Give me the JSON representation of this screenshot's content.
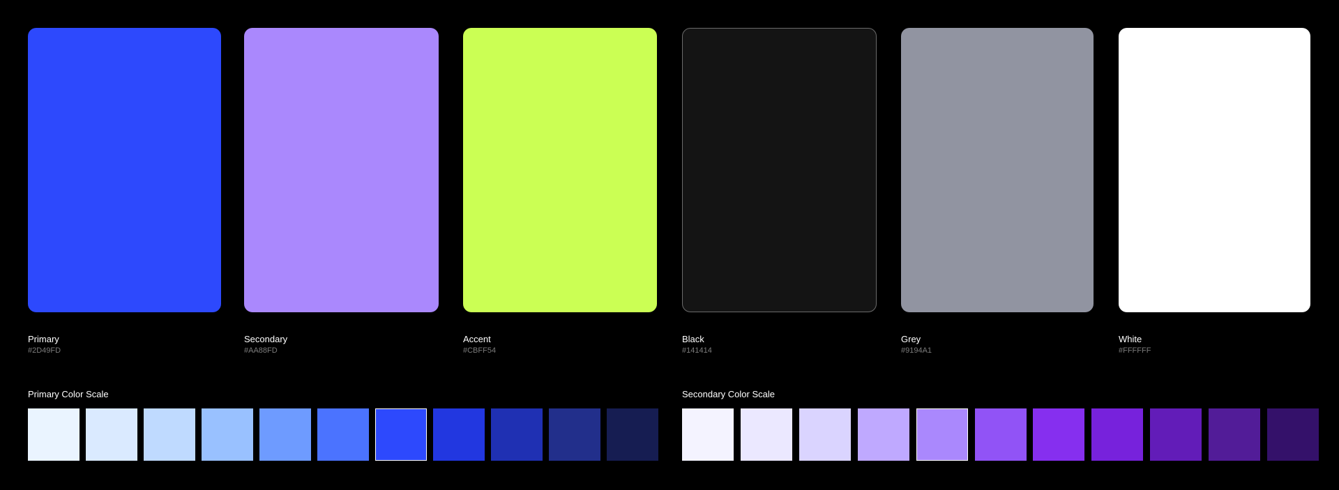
{
  "palette": [
    {
      "name": "Primary",
      "hex": "#2D49FD"
    },
    {
      "name": "Secondary",
      "hex": "#AA88FD"
    },
    {
      "name": "Accent",
      "hex": "#CBFF54"
    },
    {
      "name": "Black",
      "hex": "#141414"
    },
    {
      "name": "Grey",
      "hex": "#9194A1"
    },
    {
      "name": "White",
      "hex": "#FFFFFF"
    }
  ],
  "primary_scale": {
    "title": "Primary Color Scale",
    "colors": [
      "#EAF4FF",
      "#DAEAFF",
      "#BFDAFF",
      "#99C1FF",
      "#6E9BFF",
      "#4B73FF",
      "#2D49FD",
      "#2237E0",
      "#1F30B3",
      "#222F8B",
      "#161D52"
    ],
    "selected_index": 6
  },
  "secondary_scale": {
    "title": "Secondary Color Scale",
    "colors": [
      "#F4F3FF",
      "#EBE8FF",
      "#DAD4FF",
      "#BFA9FF",
      "#AA88FD",
      "#9153F6",
      "#862FEF",
      "#7722DC",
      "#621CB8",
      "#521C98",
      "#34116A"
    ],
    "selected_index": 4
  }
}
